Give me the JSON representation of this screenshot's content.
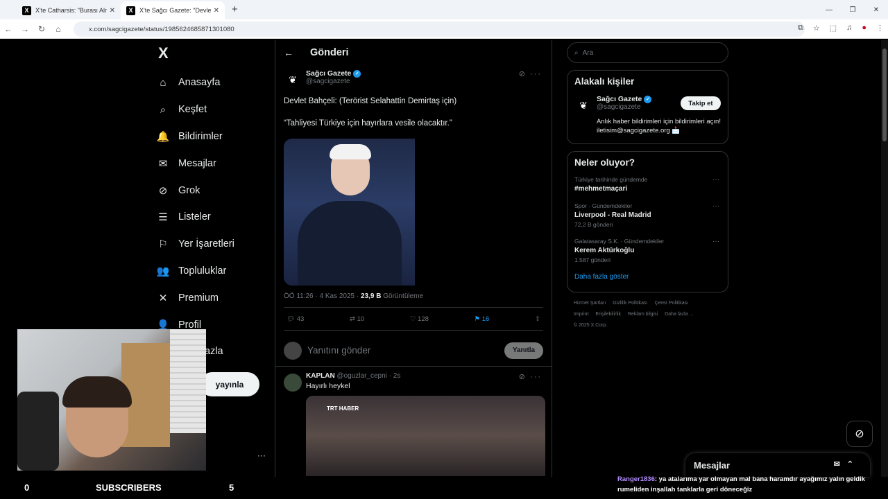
{
  "browser": {
    "tabs": [
      {
        "title": "X'te Catharsis: \"Burası Almanya",
        "active": false
      },
      {
        "title": "X'te Sağcı Gazete: \"Devlet Bahç",
        "active": true
      }
    ],
    "url": "x.com/sagcigazete/status/1985624685871301080"
  },
  "sidebar": {
    "logo": "X",
    "items": [
      {
        "label": "Anasayfa",
        "icon": "home-icon",
        "glyph": "⌂"
      },
      {
        "label": "Keşfet",
        "icon": "search-icon",
        "glyph": "⌕"
      },
      {
        "label": "Bildirimler",
        "icon": "bell-icon",
        "glyph": "🔔"
      },
      {
        "label": "Mesajlar",
        "icon": "mail-icon",
        "glyph": "✉"
      },
      {
        "label": "Grok",
        "icon": "grok-icon",
        "glyph": "⊘"
      },
      {
        "label": "Listeler",
        "icon": "list-icon",
        "glyph": "☰"
      },
      {
        "label": "Yer İşaretleri",
        "icon": "bookmark-icon",
        "glyph": "⚐"
      },
      {
        "label": "Topluluklar",
        "icon": "people-icon",
        "glyph": "👥"
      },
      {
        "label": "Premium",
        "icon": "x-premium-icon",
        "glyph": "✕"
      },
      {
        "label": "Profil",
        "icon": "person-icon",
        "glyph": "👤"
      }
    ],
    "more_partial": "azla",
    "post_button": "yayınla"
  },
  "stream_overlay": {
    "left_count": "0",
    "subscribers_label": "SUBSCRIBERS",
    "right_count": "5",
    "chat_user": "Ranger1836",
    "chat_message": ": ya atalarıma yar olmayan mal bana haramdır ayağımız yalın geldik rumeliden inşallah tanklarla geri döneceğiz"
  },
  "main": {
    "header_title": "Gönderi",
    "tweet": {
      "author_name": "Sağcı Gazete",
      "author_handle": "@sagcigazete",
      "text_line1": "Devlet Bahçeli: (Terörist Selahattin Demirtaş için)",
      "text_line2": "“Tahliyesi Türkiye için hayırlara vesile olacaktır.”",
      "time": "ÖÖ 11:26 · 4 Kas 2025 · ",
      "views_count": "23,9 B",
      "views_label": " Görüntüleme",
      "replies": "43",
      "reposts": "10",
      "likes": "128",
      "bookmarks": "16"
    },
    "reply_box": {
      "placeholder": "Yanıtını gönder",
      "button": "Yanıtla"
    },
    "comment": {
      "name": "KAPLAN",
      "handle_time": " @oguzlar_cepni · 2s",
      "text": "Hayırlı heykel",
      "media_caption": "TRT HABER"
    }
  },
  "right_panel": {
    "search_placeholder": "Ara",
    "related_title": "Alakalı kişiler",
    "person_name": "Sağcı Gazete",
    "person_handle": "@sagcigazete",
    "follow_button": "Takip et",
    "person_bio": "Anlık haber bildirimleri için bildirimleri açın! iletisim@sagcigazete.org 📩",
    "trends_title": "Neler oluyor?",
    "trends": [
      {
        "context": "Türkiye tarihinde gündemde",
        "name": "#mehmetmaçari",
        "posts": ""
      },
      {
        "context": "Spor · Gündemdekiler",
        "name": "Liverpool - Real Madrid",
        "posts": "72,2 B gönderi"
      },
      {
        "context": "Galatasaray S.K. · Gündemdekiler",
        "name": "Kerem Aktürkoğlu",
        "posts": "1.587 gönderi"
      }
    ],
    "show_more": "Daha fazla göster",
    "footer_links": [
      "Hizmet Şartları",
      "Gizlilik Politikası",
      "Çerez Politikası",
      "Imprint",
      "Erişilebilirlik",
      "Reklam bilgisi",
      "Daha fazla ..."
    ],
    "copyright": "© 2025 X Corp."
  },
  "messages_bar": {
    "title": "Mesajlar"
  },
  "colors": {
    "accent": "#1d9bf0",
    "background": "#000000",
    "border": "#2f3336"
  }
}
